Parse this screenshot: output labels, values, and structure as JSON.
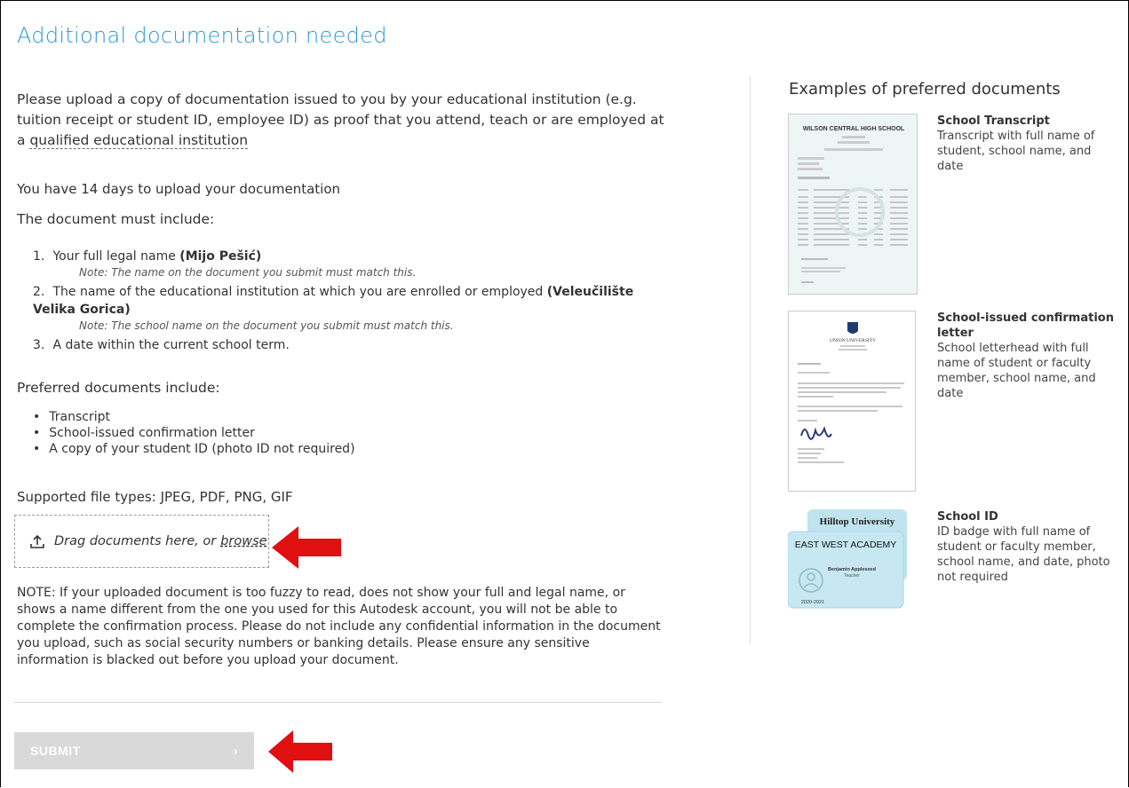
{
  "title": "Additional documentation needed",
  "intro": {
    "text_before": "Please upload a copy of documentation issued to you by your educational institution (e.g. tuition receipt or student ID, employee ID) as proof that you attend, teach or are employed at a",
    "link": "qualified educational institution"
  },
  "deadline": "You have 14 days to upload your documentation",
  "must_include_heading": "The document must include:",
  "requirements": [
    {
      "num": "1.",
      "text": "Your full legal name",
      "value": "(Mijo Pešić)",
      "note": "Note: The name on the document you submit must match this."
    },
    {
      "num": "2.",
      "text": "The name of the educational institution at which you are enrolled or employed",
      "value": "(Veleučilište Velika Gorica)",
      "note": "Note: The school name on the document you submit must match this."
    },
    {
      "num": "3.",
      "text": "A date within the current school term.",
      "value": "",
      "note": ""
    }
  ],
  "preferred_heading": "Preferred documents include:",
  "preferred": [
    "Transcript",
    "School-issued confirmation letter",
    "A copy of your student ID (photo ID not required)"
  ],
  "filetypes": "Supported file types: JPEG, PDF, PNG, GIF",
  "dropzone": {
    "text": "Drag documents here, or",
    "browse": "browse"
  },
  "note_block": "NOTE: If your uploaded document is too fuzzy to read, does not show your full and legal name, or shows a name different from the one you used for this Autodesk account, you will not be able to complete the confirmation process. Please do not include any confidential information in the document you upload, such as social security numbers or banking details. Please ensure any sensitive information is blacked out before you upload your document.",
  "submit": {
    "label": "SUBMIT",
    "chevron": "›"
  },
  "examples": {
    "title": "Examples of preferred documents",
    "items": [
      {
        "heading": "School Transcript",
        "desc": "Transcript with full name of student, school name, and date",
        "thumb_title": "WILSON CENTRAL HIGH SCHOOL"
      },
      {
        "heading": "School-issued confirmation letter",
        "desc": "School letterhead with full name of student or faculty member, school name, and date",
        "thumb_title": "UNION UNIVERSITY"
      },
      {
        "heading": "School ID",
        "desc": "ID badge with full name of student or faculty member, school name, and date, photo not required",
        "card_back": "Hilltop University",
        "card_front": "EAST WEST ACADEMY",
        "card_name": "Benjamin Appleseed",
        "card_role": "Teacher",
        "card_year": "2020-2021"
      }
    ]
  },
  "colors": {
    "title": "#2b98d6",
    "arrow": "#e01010",
    "submit_bg": "#d9d9d9",
    "id_card": "#bfe3ef"
  }
}
